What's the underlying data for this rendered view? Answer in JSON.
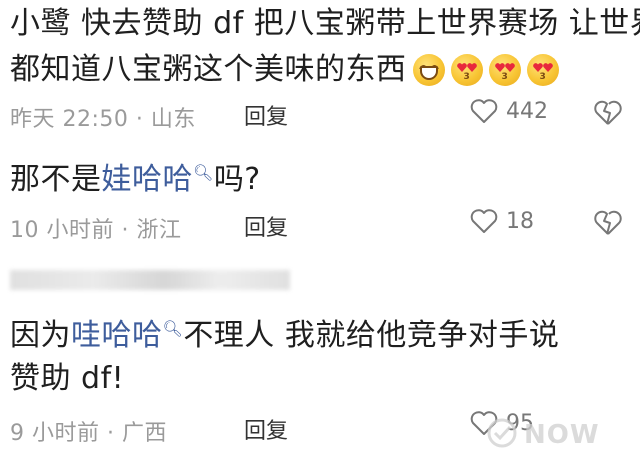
{
  "comments": [
    {
      "lines": [
        "小鹭 快去赞助 df 把八宝粥带上世界赛场 让世界",
        "都知道八宝粥这个美味的东西"
      ],
      "emojis": [
        "grinning-emoji",
        "heart-eyes-emoji",
        "heart-eyes-emoji",
        "heart-eyes-emoji"
      ],
      "meta": "昨天 22:50 · 山东",
      "reply_label": "回复",
      "likes": "442"
    },
    {
      "before": "那不是",
      "mention": "娃哈哈",
      "after": "吗?",
      "meta": "10 小时前 · 浙江",
      "reply_label": "回复",
      "likes": "18"
    },
    {
      "before": "因为",
      "mention": "哇哈哈",
      "after": "不理人 我就给他竞争对手说",
      "line2": "赞助 df!",
      "meta": "9 小时前 · 广西",
      "reply_label": "回复",
      "likes": "95"
    }
  ],
  "watermark": "NOW",
  "colors": {
    "text": "#1f1f1f",
    "meta": "#9a9a9a",
    "mention": "#3e5d9c",
    "icon": "#777777"
  }
}
